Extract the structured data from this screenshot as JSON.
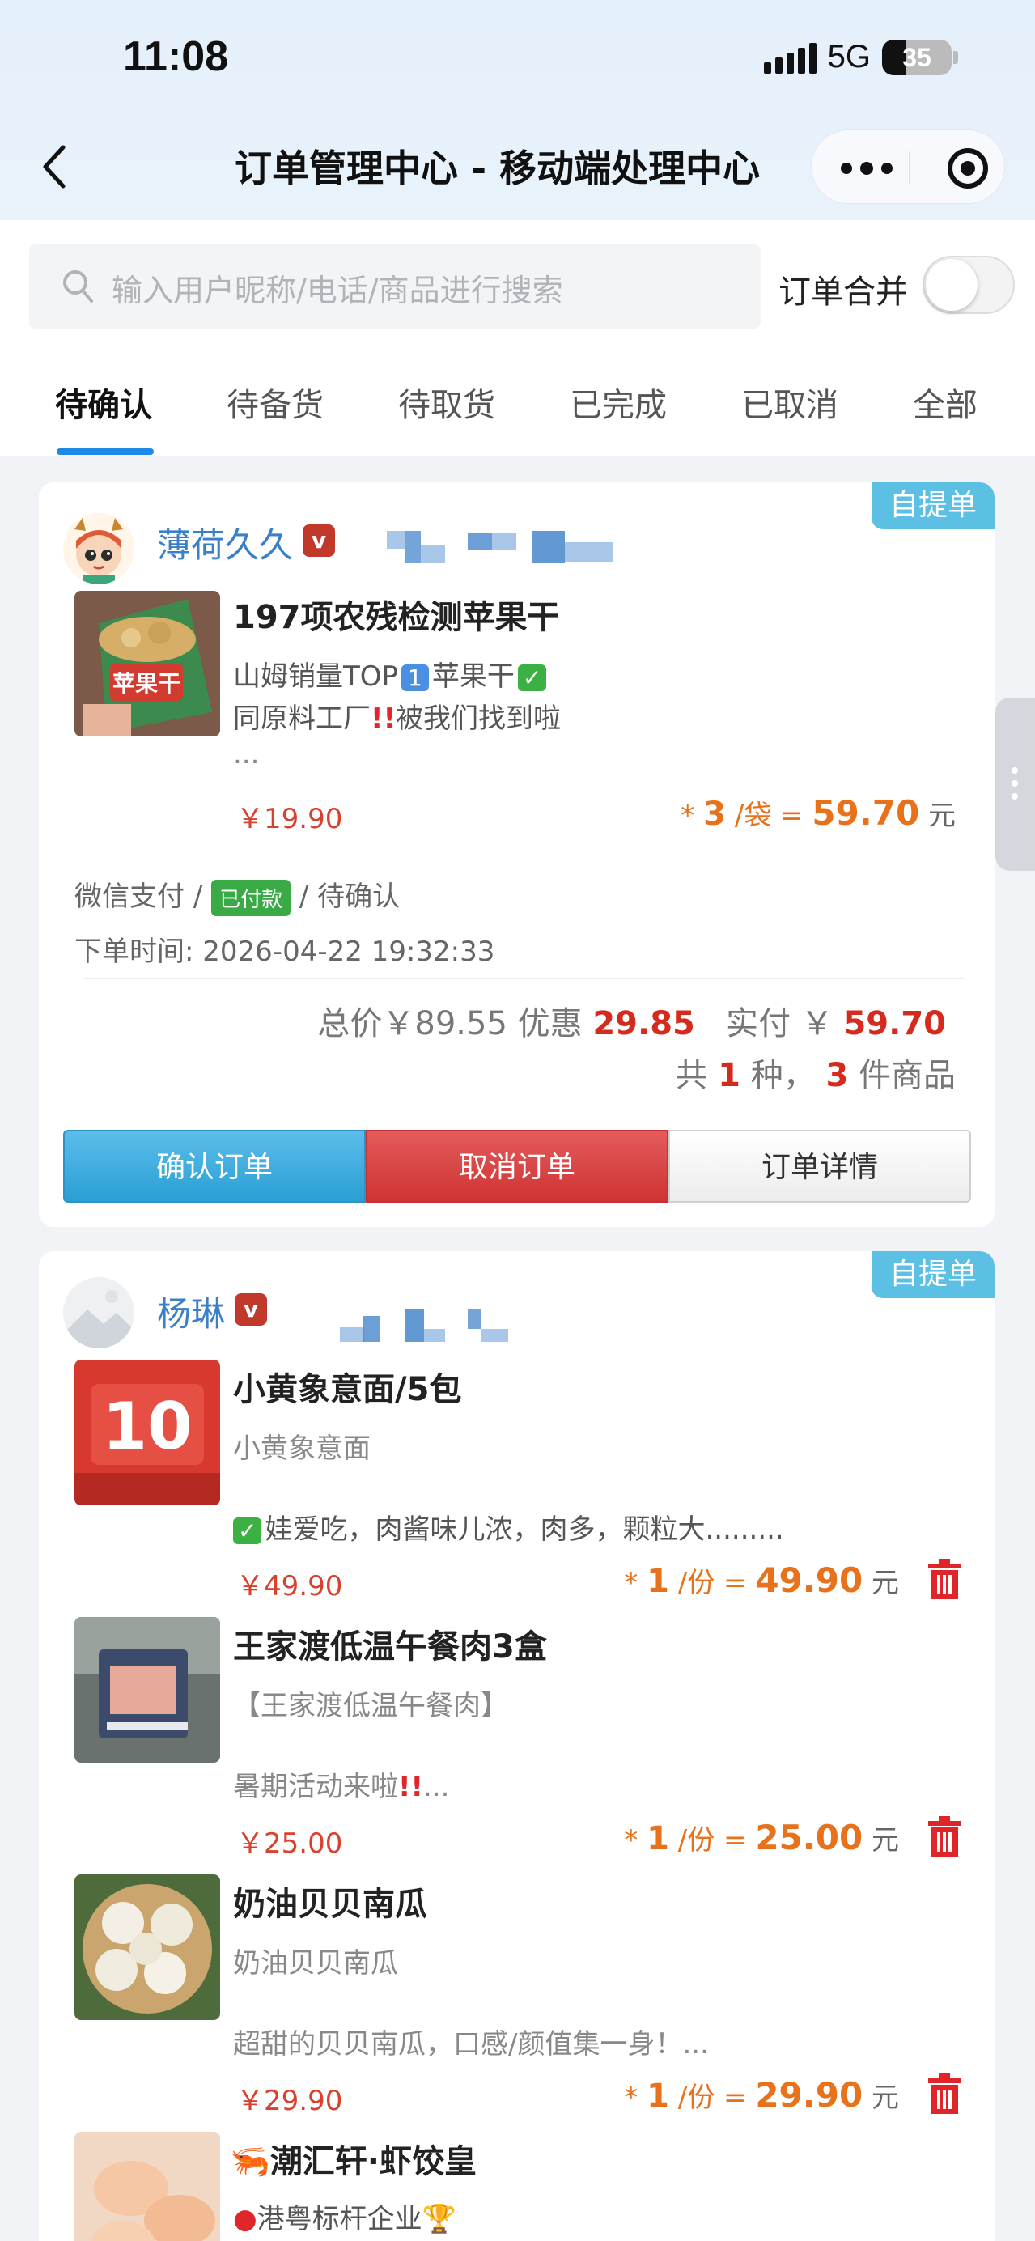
{
  "status_bar": {
    "time": "11:08",
    "network": "5G",
    "battery": "35",
    "battery_level": 0.35
  },
  "nav": {
    "title": "订单管理中心 - 移动端处理中心"
  },
  "search": {
    "placeholder": "输入用户昵称/电话/商品进行搜索",
    "merge_label": "订单合并",
    "merge_on": false
  },
  "tabs": [
    {
      "label": "待确认",
      "active": true
    },
    {
      "label": "待备货",
      "active": false
    },
    {
      "label": "待取货",
      "active": false
    },
    {
      "label": "已完成",
      "active": false
    },
    {
      "label": "已取消",
      "active": false
    },
    {
      "label": "全部",
      "active": false
    }
  ],
  "orders": [
    {
      "badge": "自提单",
      "user": "薄荷久久",
      "verify": "v",
      "items": [
        {
          "name": "197项农残检测苹果干",
          "thumb_text": "苹果干",
          "desc1": "山姆销量TOP",
          "desc1_num": "1",
          "desc1_tail": "苹果干",
          "desc2": "同原料工厂",
          "desc2_tail": "被我们找到啦",
          "desc3": "...",
          "unit_price": "￥19.90",
          "qty_prefix": "*",
          "qty": "3",
          "unit": "/袋 =",
          "total": "59.70",
          "currency": "元"
        }
      ],
      "pay_method": "微信支付 /",
      "pay_status": "已付款",
      "order_status": "/ 待确认",
      "order_time_label": "下单时间:",
      "order_time": "2026-04-22 19:32:33",
      "total_label": "总价￥89.55 优惠",
      "discount": "29.85",
      "paid_label": "实付 ￥",
      "paid": "59.70",
      "count_prefix": "共",
      "kinds": "1",
      "count_mid": "种，",
      "pieces": "3",
      "count_suffix": "件商品",
      "buttons": {
        "confirm": "确认订单",
        "cancel": "取消订单",
        "detail": "订单详情"
      }
    },
    {
      "badge": "自提单",
      "user": "杨琳",
      "verify": "v",
      "items": [
        {
          "name": "小黄象意面/5包",
          "desc1": "小黄象意面",
          "desc2": "娃爱吃，肉酱味儿浓，肉多，颗粒大.........",
          "unit_price": "￥49.90",
          "qty_prefix": "*",
          "qty": "1",
          "unit": "/份 =",
          "total": "49.90",
          "currency": "元"
        },
        {
          "name": "王家渡低温午餐肉3盒",
          "desc1": "【王家渡低温午餐肉】",
          "desc2": "暑期活动来啦",
          "desc2_tail": "...",
          "unit_price": "￥25.00",
          "qty_prefix": "*",
          "qty": "1",
          "unit": "/份 =",
          "total": "25.00",
          "currency": "元"
        },
        {
          "name": "奶油贝贝南瓜",
          "desc1": "奶油贝贝南瓜",
          "desc2": "超甜的贝贝南瓜，口感/颜值集一身！...",
          "unit_price": "￥29.90",
          "qty_prefix": "*",
          "qty": "1",
          "unit": "/份 =",
          "total": "29.90",
          "currency": "元"
        },
        {
          "name": "潮汇轩·虾饺皇",
          "desc1": "港粤标杆企业"
        }
      ]
    }
  ],
  "colors": {
    "accent_blue": "#1e88e5",
    "badge_blue": "#5bc0e4",
    "price_red": "#d52b1e",
    "price_orange": "#e8711c",
    "confirm_btn": "#2a9fd4",
    "cancel_btn": "#cf3333",
    "paid_green": "#3aaa46"
  }
}
